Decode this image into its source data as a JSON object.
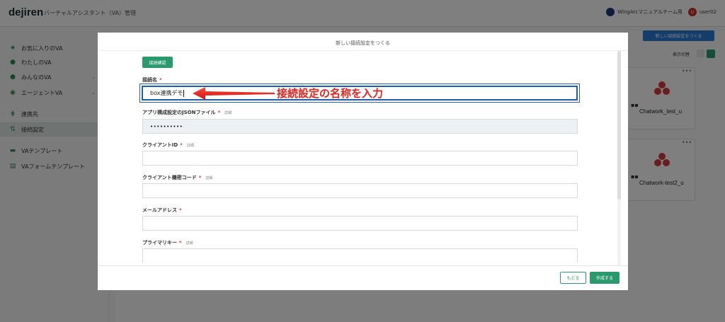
{
  "header": {
    "logo": "dejiren",
    "app_title": "バーチャルアシスタント（VA）管理",
    "org_name": "WingArcマニュアルチーム用",
    "user_initial": "U",
    "user_name": "user02"
  },
  "sidebar": {
    "items": [
      {
        "label": "お気に入りのVA",
        "icon": "star-icon"
      },
      {
        "label": "わたしのVA",
        "icon": "person-icon"
      },
      {
        "label": "みんなのVA",
        "icon": "people-icon"
      },
      {
        "label": "エージェントVA",
        "icon": "eye-icon"
      },
      {
        "label": "連携先",
        "icon": "link-icon"
      },
      {
        "label": "接続設定",
        "icon": "sliders-icon"
      },
      {
        "label": "VAテンプレート",
        "icon": "template-icon"
      },
      {
        "label": "VAフォームテンプレート",
        "icon": "form-template-icon"
      }
    ]
  },
  "main": {
    "new_connection_button": "新しい接続設定をつくる",
    "view_toggle_label": "表示切替",
    "cards": [
      {
        "name": "Chatwork_test_u"
      },
      {
        "name": "Chatwork-test2_u"
      }
    ],
    "card_more": "•••"
  },
  "modal": {
    "title": "新しい接続設定をつくる",
    "check_button": "接続確認",
    "fields": {
      "connection_name": {
        "label": "接続名",
        "value": "box連携デモ"
      },
      "json_file": {
        "label": "アプリ構成設定のJSONファイル",
        "detail": "詳細",
        "value": "••••••••••"
      },
      "client_id": {
        "label": "クライアントID",
        "detail": "詳細",
        "value": ""
      },
      "client_secret": {
        "label": "クライアント機密コード",
        "detail": "詳細",
        "value": ""
      },
      "email": {
        "label": "メールアドレス",
        "value": ""
      },
      "primary_key": {
        "label": "プライマリキー",
        "detail": "詳細",
        "value": ""
      }
    },
    "required_mark": "*",
    "back_button": "もどる",
    "create_button": "作成する"
  },
  "annotation": {
    "text": "接続設定の名称を入力",
    "color": "#e8231d"
  },
  "colors": {
    "accent_green": "#2a9a6c",
    "button_blue": "#2a7bd8",
    "highlight_blue": "#1f5fae"
  }
}
